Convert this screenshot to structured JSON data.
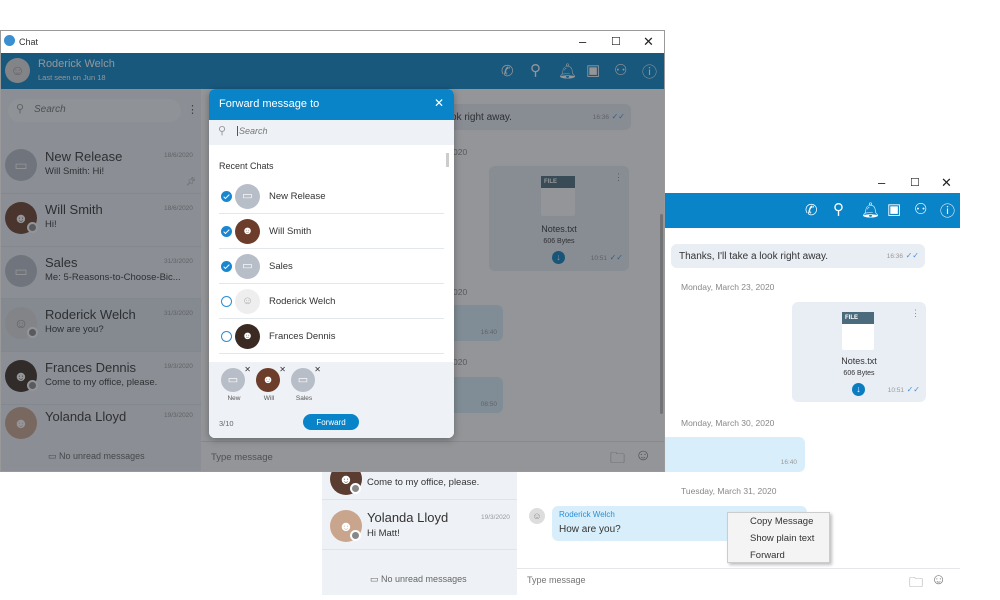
{
  "back_window": {
    "title": "Chat",
    "contact": {
      "name": "Roderick Welch",
      "status": "Last seen on Jun 18"
    },
    "search_placeholder": "Search",
    "chats": [
      {
        "name": "New Release",
        "preview": "Will Smith: Hi!",
        "date": "18/6/2020",
        "pinned": true
      },
      {
        "name": "Will Smith",
        "preview": "Hi!",
        "date": "18/6/2020"
      },
      {
        "name": "Sales",
        "preview": "Me: 5-Reasons-to-Choose-Bic...",
        "date": "31/3/2020"
      },
      {
        "name": "Roderick Welch",
        "preview": "How are you?",
        "date": "31/3/2020"
      },
      {
        "name": "Frances Dennis",
        "preview": "Come to my office, please.",
        "date": "19/3/2020"
      },
      {
        "name": "Yolanda Lloyd",
        "preview": "",
        "date": "19/3/2020"
      }
    ],
    "no_unread": "No unread messages",
    "messages": {
      "text_partial": "ok right away.",
      "text_time": "16:36",
      "day1_partial": "020",
      "file": {
        "badge": "FILE",
        "name": "Notes.txt",
        "size": "606 Bytes",
        "time": "10:51"
      },
      "day2_partial": "020",
      "bubble1_time": "16:40",
      "day3_partial": "020",
      "bubble2_time": "08:50"
    },
    "input_placeholder": "Type message"
  },
  "dialog": {
    "title": "Forward message to",
    "search_placeholder": "Search",
    "section": "Recent Chats",
    "contacts": [
      {
        "name": "New Release",
        "checked": true
      },
      {
        "name": "Will Smith",
        "checked": true
      },
      {
        "name": "Sales",
        "checked": true
      },
      {
        "name": "Roderick Welch",
        "checked": false
      },
      {
        "name": "Frances Dennis",
        "checked": false
      }
    ],
    "selected": [
      "New",
      "Will",
      "Sales"
    ],
    "count": "3/10",
    "forward_label": "Forward"
  },
  "front_window": {
    "messages": {
      "text": "Thanks, I'll take a look right away.",
      "text_time": "16:36",
      "day1": "Monday, March 23, 2020",
      "file": {
        "badge": "FILE",
        "name": "Notes.txt",
        "size": "606 Bytes",
        "time": "10:51"
      },
      "day2": "Monday, March 30, 2020",
      "bubble_time": "16:40",
      "day3": "Tuesday, March 31, 2020",
      "incoming_sender": "Roderick Welch",
      "incoming_text": "How are you?"
    },
    "chats": [
      {
        "preview": "Come to my office, please."
      },
      {
        "name": "Yolanda Lloyd",
        "preview": "Hi Matt!",
        "date": "19/3/2020"
      }
    ],
    "no_unread": "No unread messages",
    "input_placeholder": "Type message",
    "context_menu": [
      "Copy Message",
      "Show plain text",
      "Forward"
    ]
  },
  "colors": {
    "accent": "#0a84c8",
    "dialog_header": "#0a84c8",
    "sidebar": "#eef1f6"
  }
}
